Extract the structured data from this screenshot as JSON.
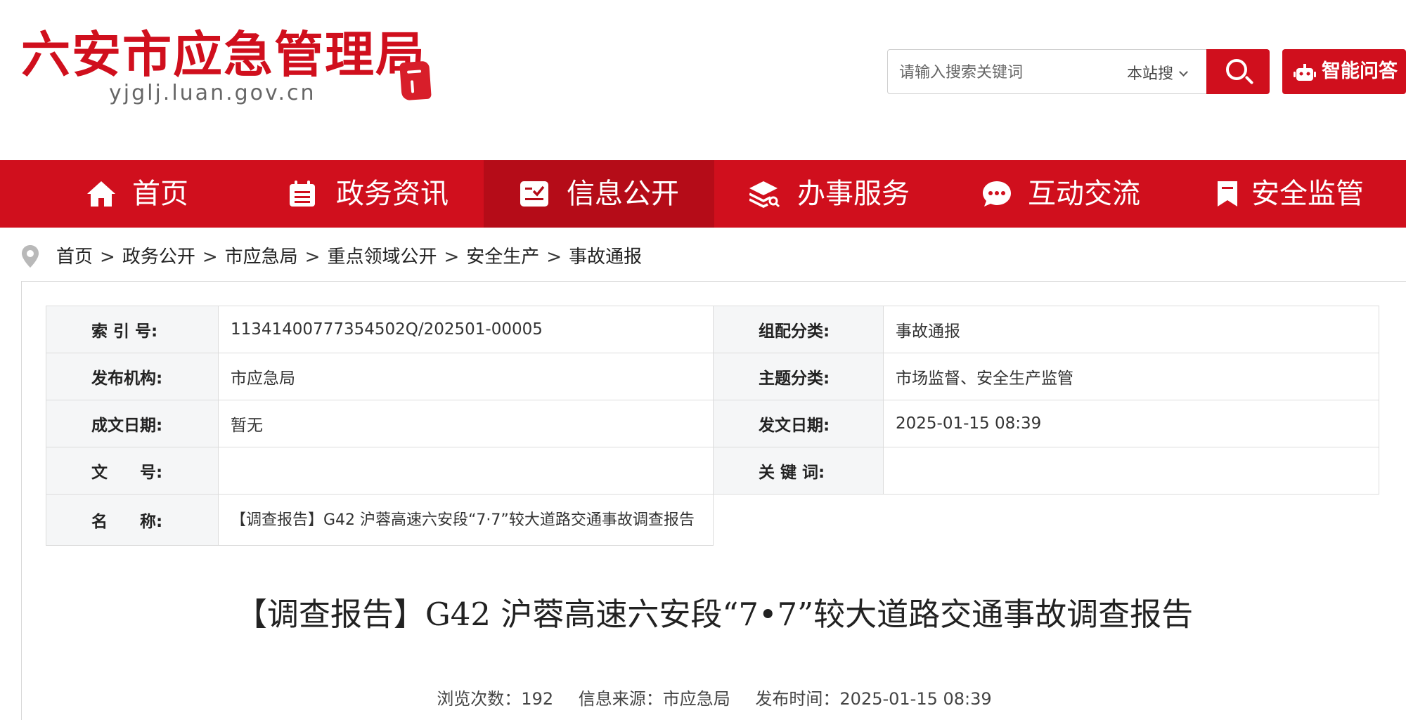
{
  "site": {
    "title": "六安市应急管理局",
    "domain": "yjglj.luan.gov.cn"
  },
  "search": {
    "placeholder": "请输入搜索关键词",
    "scope": "本站搜",
    "ai_label": "智能问答"
  },
  "nav": {
    "items": [
      {
        "label": "首页",
        "icon": "home-icon"
      },
      {
        "label": "政务资讯",
        "icon": "calendar-icon"
      },
      {
        "label": "信息公开",
        "icon": "document-check-icon"
      },
      {
        "label": "办事服务",
        "icon": "layers-icon"
      },
      {
        "label": "互动交流",
        "icon": "chat-icon"
      },
      {
        "label": "安全监管",
        "icon": "bookmark-icon"
      }
    ],
    "active_index": 2
  },
  "breadcrumb": [
    "首页",
    "政务公开",
    "市应急局",
    "重点领域公开",
    "安全生产",
    "事故通报"
  ],
  "breadcrumb_sep": ">",
  "meta": {
    "index_label": "索 引 号:",
    "index_value": "11341400777354502Q/202501-00005",
    "category_label": "组配分类:",
    "category_value": "事故通报",
    "publisher_label": "发布机构:",
    "publisher_value": "市应急局",
    "topic_label": "主题分类:",
    "topic_value": "市场监督、安全生产监管",
    "created_label": "成文日期:",
    "created_value": "暂无",
    "issued_label": "发文日期:",
    "issued_value": "2025-01-15 08:39",
    "docno_label": "文　　号:",
    "docno_value": "",
    "keywords_label": "关 键 词:",
    "keywords_value": "",
    "name_label": "名　　称:",
    "name_value": "【调查报告】G42 沪蓉高速六安段“7·7”较大道路交通事故调查报告"
  },
  "article": {
    "title": "【调查报告】G42 沪蓉高速六安段“7•7”较大道路交通事故调查报告",
    "views": "浏览次数：192",
    "source": "信息来源：市应急局",
    "published": "发布时间：2025-01-15 08:39"
  },
  "colors": {
    "brand_red": "#d00f1d",
    "active_nav": "#b50c18"
  }
}
